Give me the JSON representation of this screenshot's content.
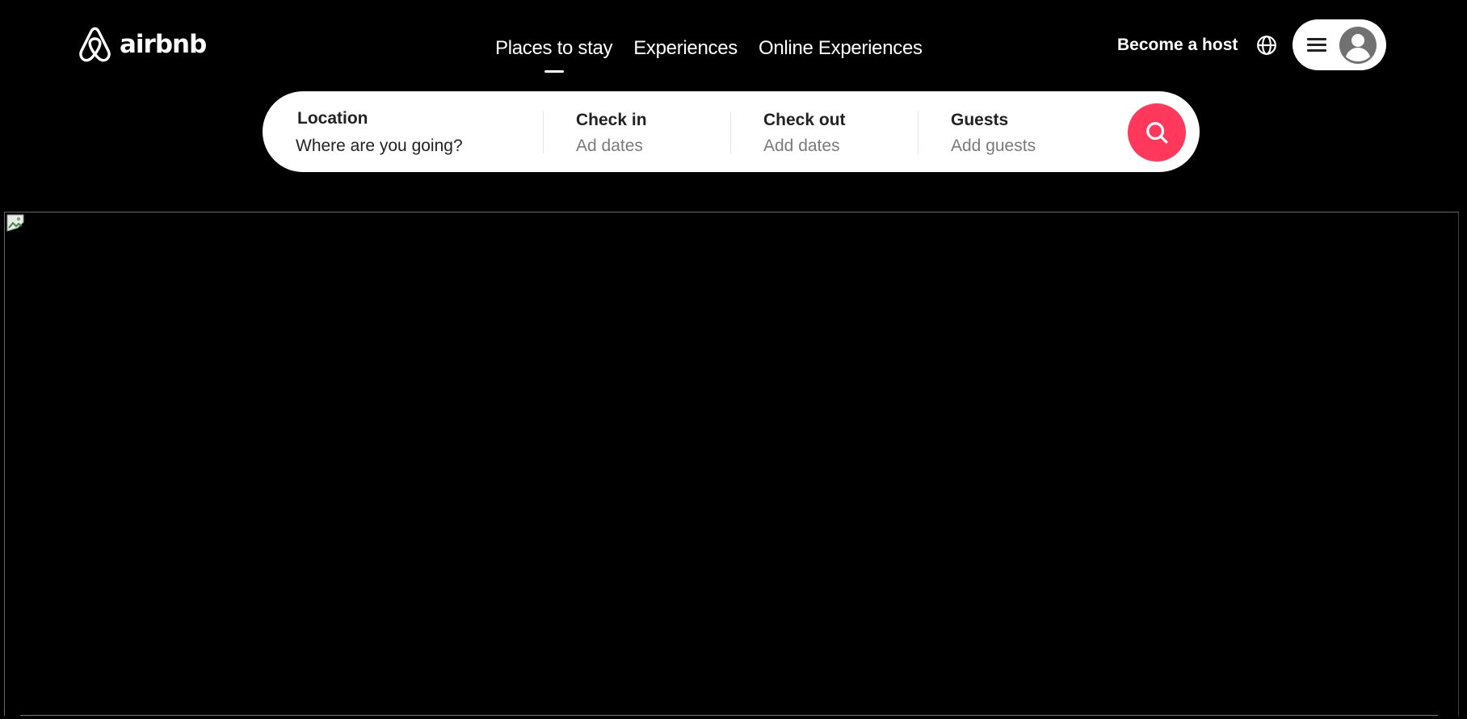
{
  "brand": {
    "name": "airbnb",
    "color": "#ffffff",
    "logo_icon": "airbnb-belo-icon"
  },
  "nav": {
    "items": [
      {
        "label": "Places to stay",
        "active": true
      },
      {
        "label": "Experiences",
        "active": false
      },
      {
        "label": "Online Experiences",
        "active": false
      }
    ]
  },
  "header_actions": {
    "host_label": "Become a host",
    "globe_icon": "globe-icon",
    "menu_icon": "hamburger-menu-icon",
    "avatar_icon": "user-avatar-icon"
  },
  "search": {
    "location": {
      "label": "Location",
      "placeholder": "Where are you going?"
    },
    "check_in": {
      "label": "Check in",
      "value": "Ad dates"
    },
    "check_out": {
      "label": "Check out",
      "value": "Add dates"
    },
    "guests": {
      "label": "Guests",
      "value": "Add guests"
    },
    "button_icon": "search-icon",
    "button_color": "#ff385c"
  },
  "hero": {
    "image_state": "broken-image-icon"
  },
  "colors": {
    "background": "#000000",
    "search_bar": "#ffffff",
    "accent": "#ff385c",
    "muted_text": "#7a7a7a"
  }
}
